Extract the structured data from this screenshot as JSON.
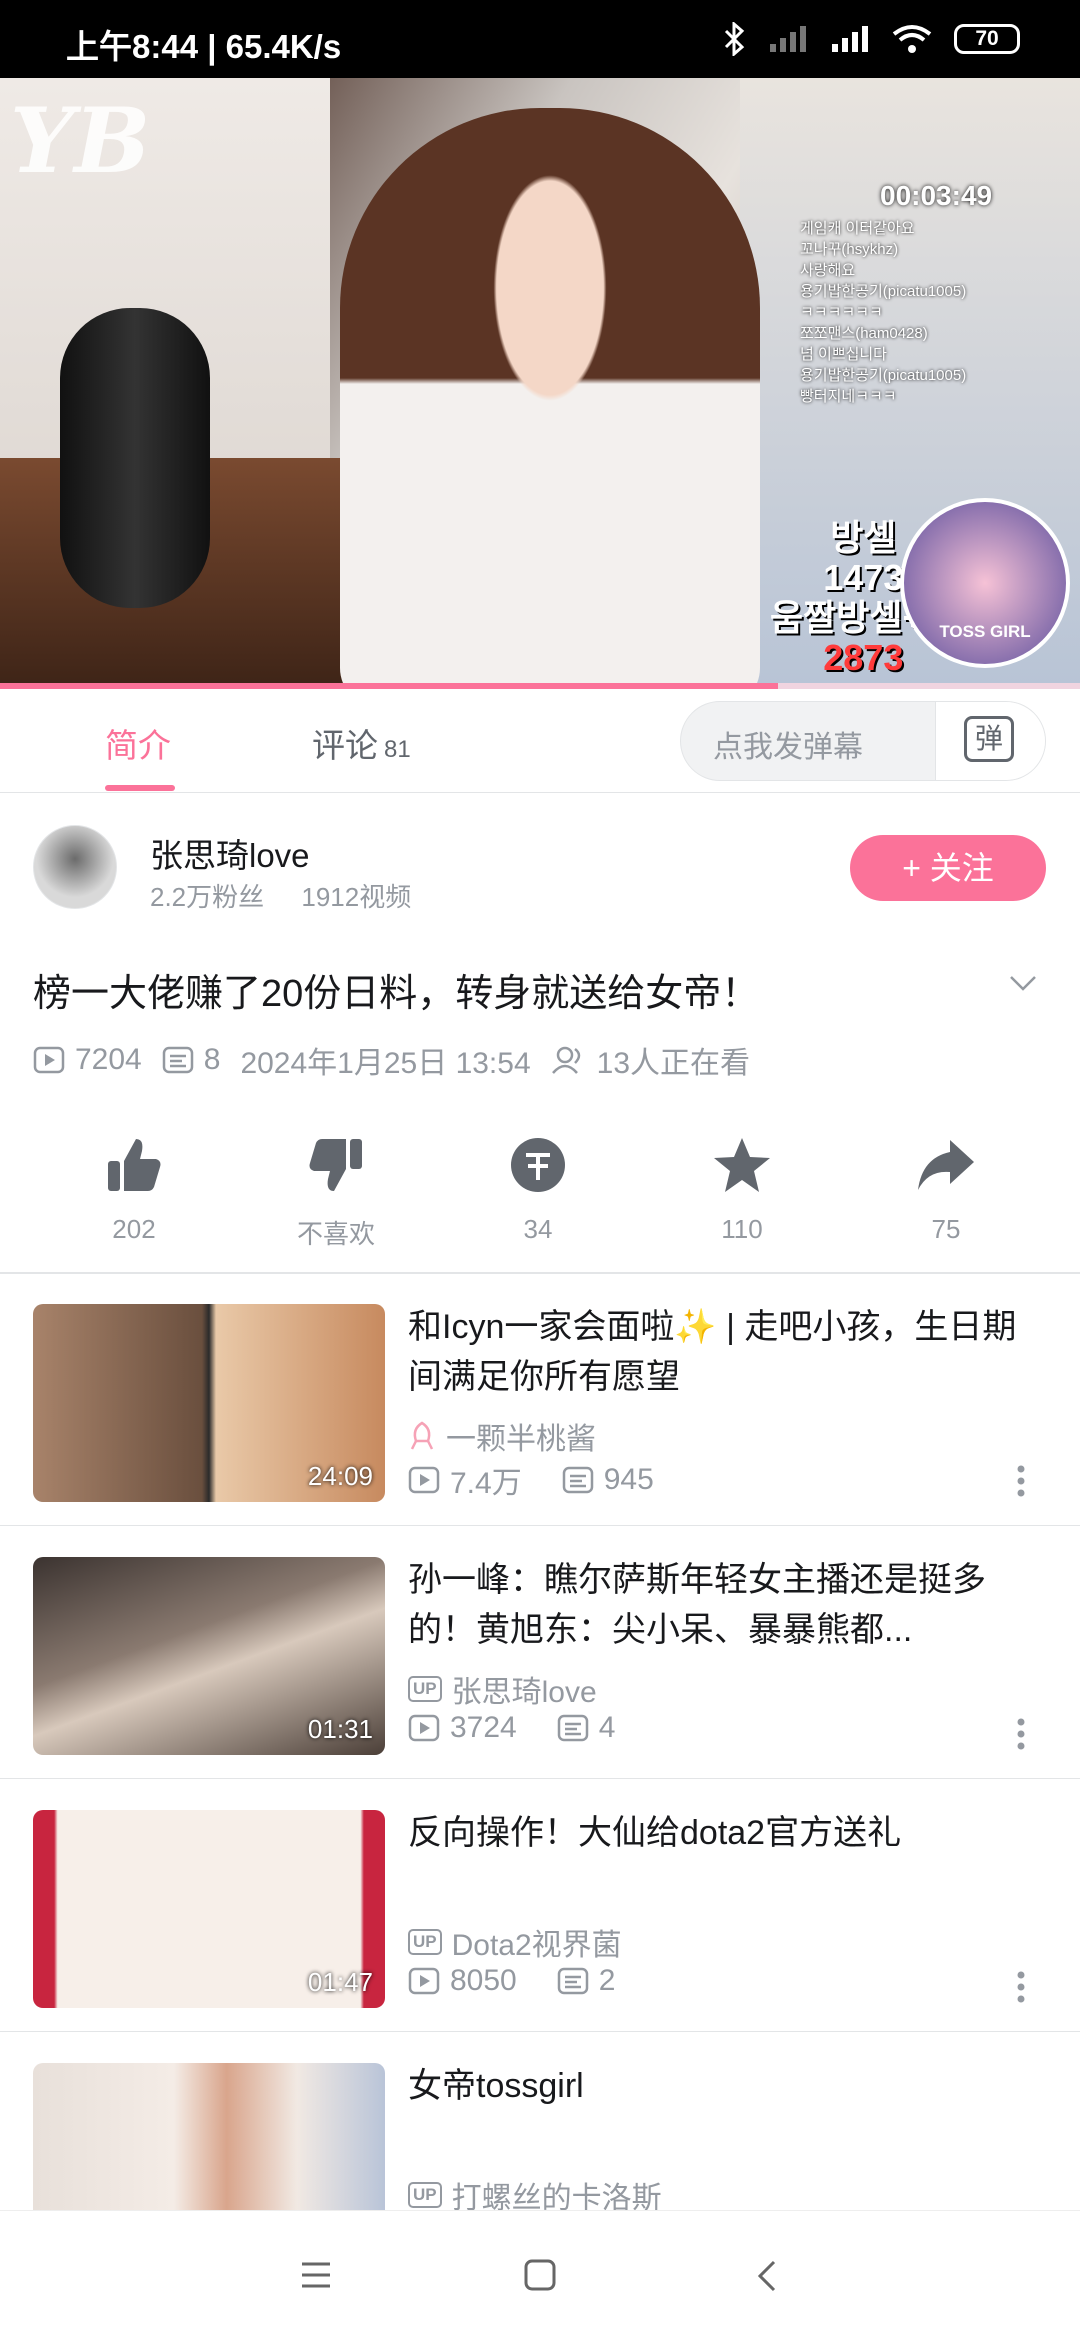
{
  "status_bar": {
    "time": "上午8:44 | 65.4K/s",
    "battery": "70"
  },
  "video": {
    "overlay_timer": "00:03:49",
    "overlay_logo": "YB",
    "overlay_chat": [
      "게임캐 이터같아요",
      "꼬나꾸(hsykhz)",
      "사랑해요",
      "용기밥한공기(picatu1005)",
      "ㅋㅋㅋㅋㅋㅋ",
      "쪼쪼맨스(ham0428)",
      "넘 이쁘십니다",
      "용기밥한공기(picatu1005)",
      "빵터지네ㅋㅋㅋ"
    ],
    "overlay_score_label_1": "방셀",
    "overlay_score_1": "1473",
    "overlay_score_label_2": "움짤방셀+닉",
    "overlay_score_2": "2873",
    "overlay_badge": "TOSS GIRL",
    "progress": 0.72
  },
  "tabs": {
    "intro": "简介",
    "comments": "评论",
    "comments_count": "81",
    "danmaku_placeholder": "点我发弹幕",
    "danmaku_button": "弹"
  },
  "uploader": {
    "name": "张思琦love",
    "fans": "2.2万粉丝",
    "videos": "1912视频",
    "follow_label": "+ 关注"
  },
  "video_info": {
    "title": "榜一大佬赚了20份日料，转身就送给女帝！",
    "views": "7204",
    "danmaku": "8",
    "date": "2024年1月25日 13:54",
    "watching": "13人正在看"
  },
  "actions": {
    "like": "202",
    "dislike": "不喜欢",
    "coin": "34",
    "favorite": "110",
    "share": "75"
  },
  "related": [
    {
      "title": "和Icyn一家会面啦✨ | 走吧小孩，生日期间满足你所有愿望",
      "author": "一颗半桃酱",
      "views": "7.4万",
      "danmaku": "945",
      "duration": "24:09"
    },
    {
      "title": "孙一峰：瞧尔萨斯年轻女主播还是挺多的！黄旭东：尖小呆、暴暴熊都...",
      "author": "张思琦love",
      "views": "3724",
      "danmaku": "4",
      "duration": "01:31"
    },
    {
      "title": "反向操作！大仙给dota2官方送礼",
      "author": "Dota2视界菌",
      "views": "8050",
      "danmaku": "2",
      "duration": "01:47"
    },
    {
      "title": "女帝tossgirl",
      "author": "打螺丝的卡洛斯",
      "views": "",
      "danmaku": "",
      "duration": ""
    }
  ],
  "colors": {
    "accent": "#fb7299",
    "secondary_text": "#9499a0",
    "icon": "#61666d"
  }
}
